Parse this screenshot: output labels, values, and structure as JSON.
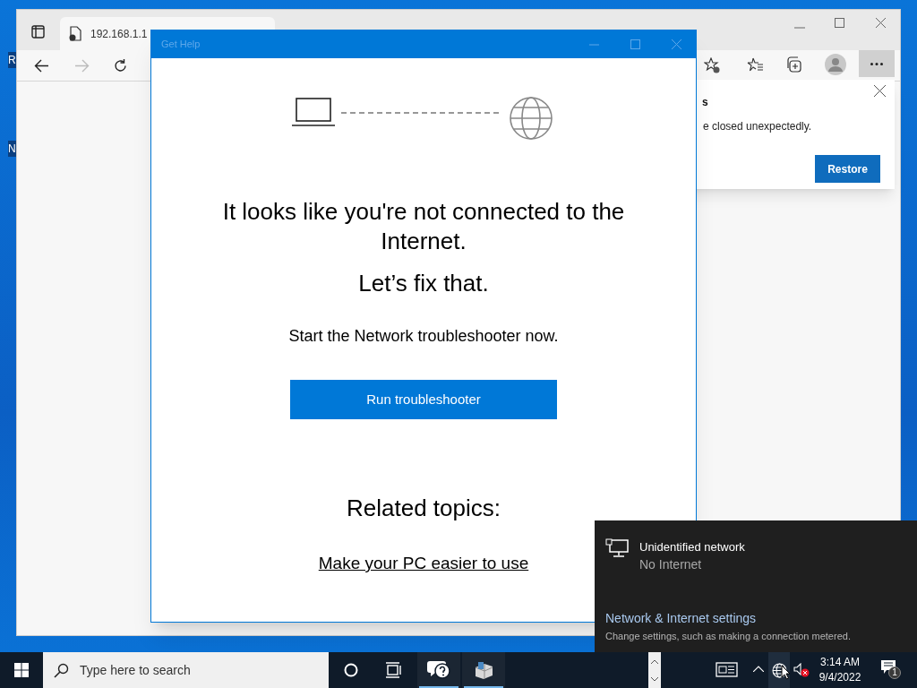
{
  "desktop": {
    "icon_labels": [
      "R",
      "N"
    ]
  },
  "browser": {
    "tab_title": "192.168.1.1",
    "restore_popup": {
      "title": "s",
      "message": "e closed unexpectedly.",
      "button": "Restore"
    }
  },
  "get_help": {
    "title": "Get Help",
    "heading": "It looks like you're not connected to the Internet.",
    "subheading": "Let’s fix that.",
    "prompt": "Start the Network troubleshooter now.",
    "button": "Run troubleshooter",
    "related_heading": "Related topics:",
    "related_links": [
      "Make your PC easier to use"
    ]
  },
  "network_flyout": {
    "network_name": "Unidentified network",
    "network_status": "No Internet",
    "settings_link": "Network & Internet settings",
    "settings_hint": "Change settings, such as making a connection metered."
  },
  "taskbar": {
    "search_placeholder": "Type here to search",
    "apps": [
      {
        "kind": "help",
        "selected": true
      },
      {
        "kind": "app",
        "selected": true
      }
    ],
    "time": "3:14 AM",
    "date": "9/4/2022",
    "notification_count": "1"
  }
}
